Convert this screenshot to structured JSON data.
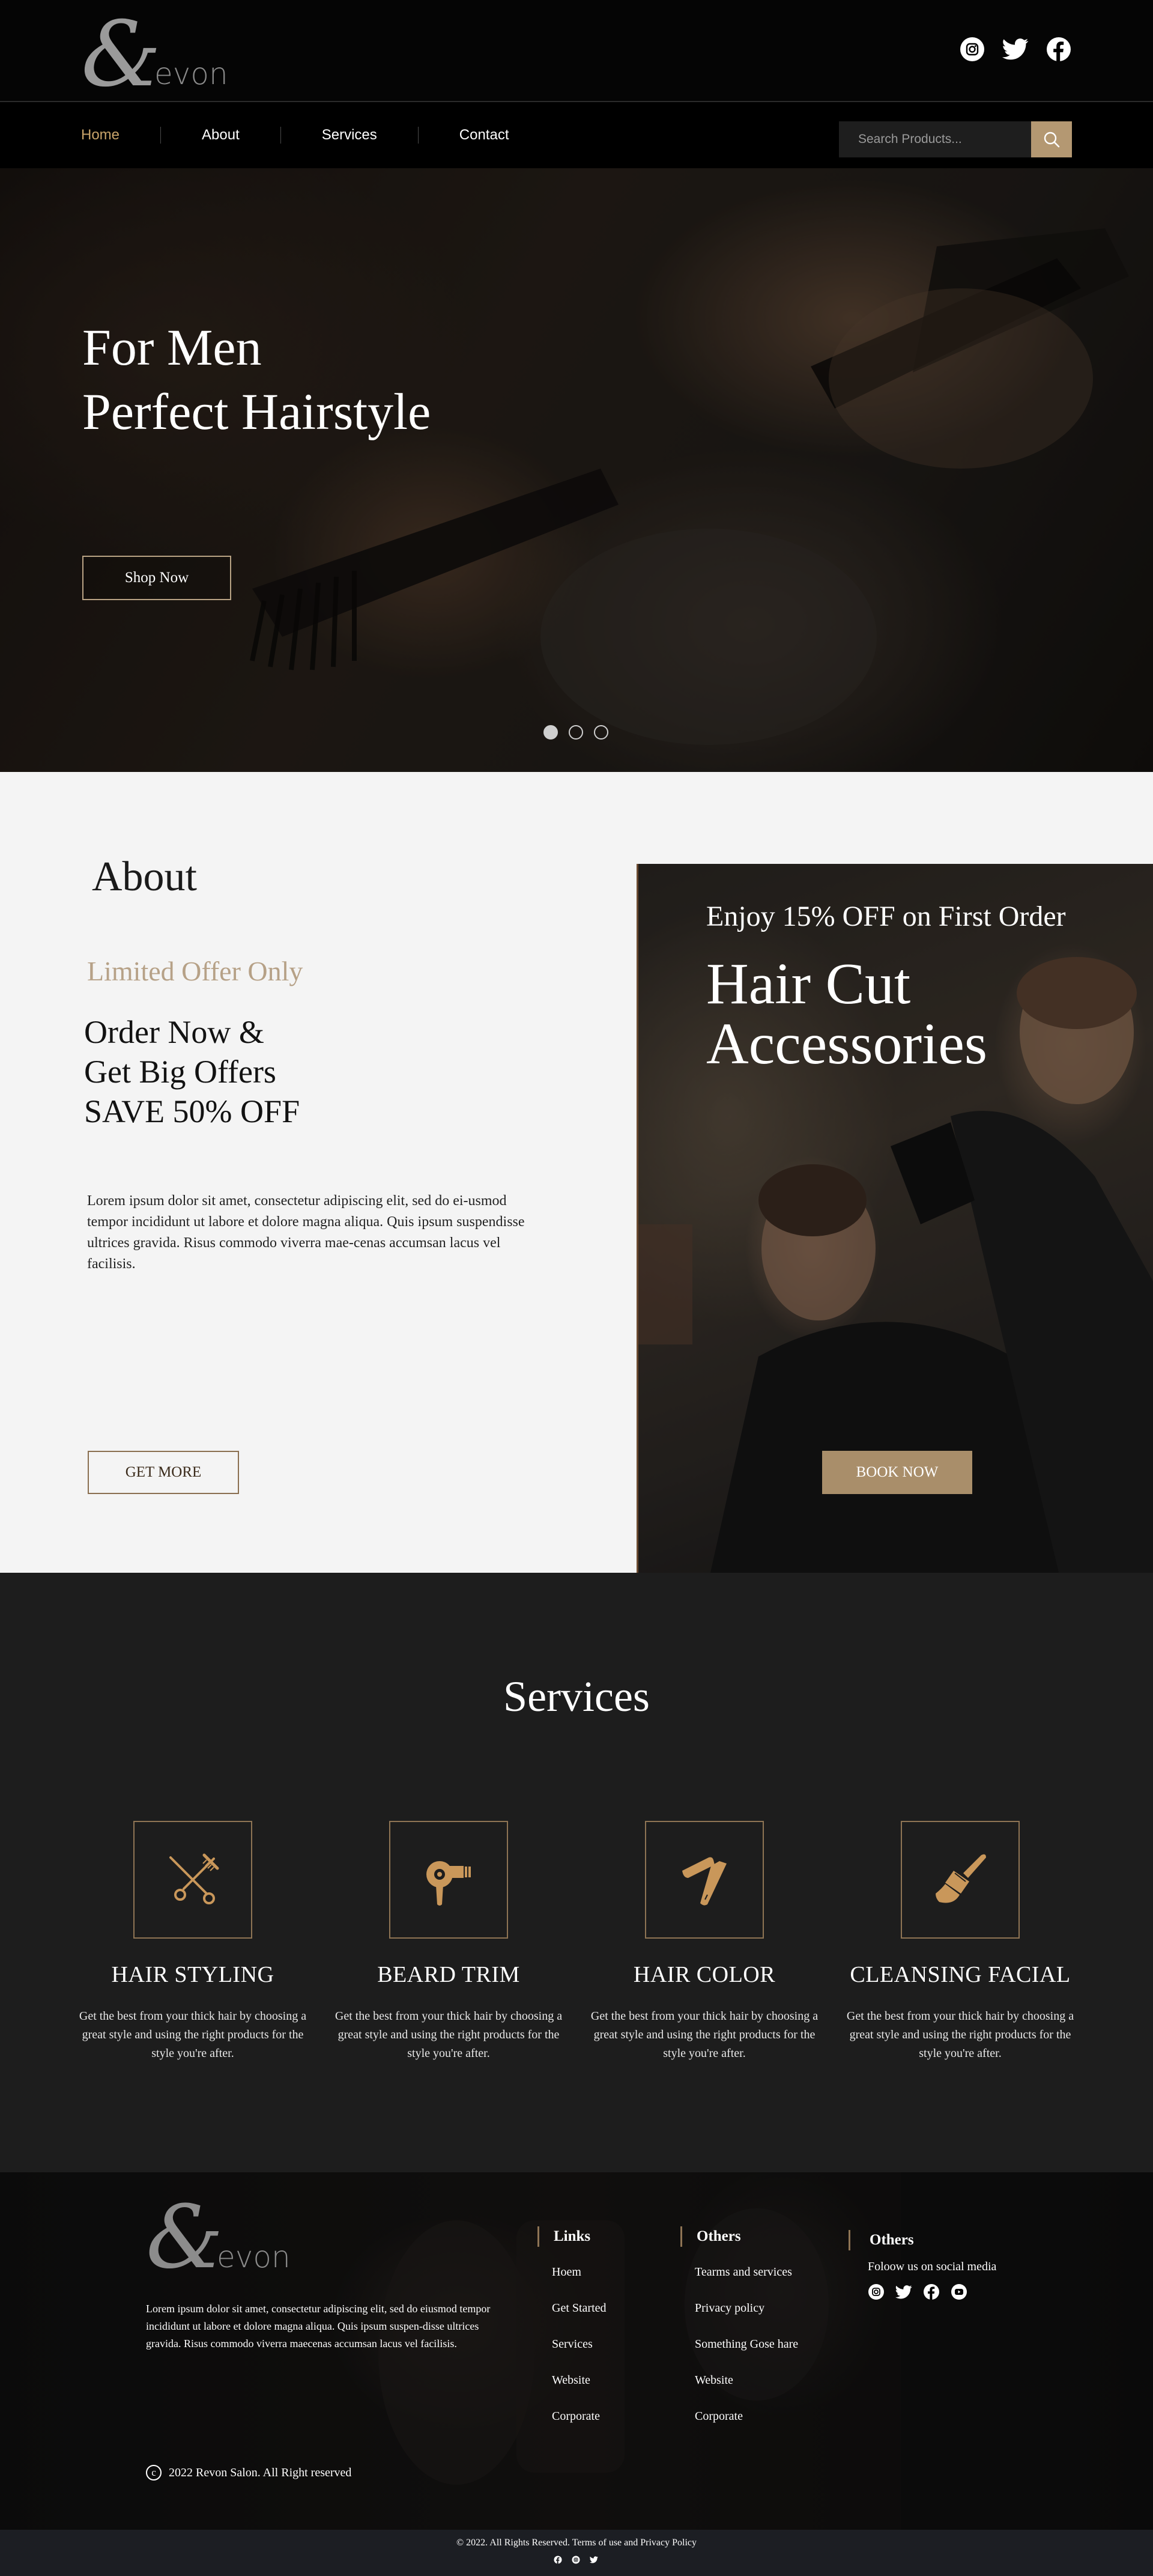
{
  "brand": {
    "monogram": "&",
    "name": "evon"
  },
  "colors": {
    "accent": "#c9a46a",
    "gold_border": "#8e7454",
    "dark": "#1d1d1d",
    "light_bg": "#f4f4f4"
  },
  "header": {
    "social_icons": [
      "instagram-icon",
      "twitter-icon",
      "facebook-icon"
    ]
  },
  "nav": {
    "items": [
      {
        "label": "Home",
        "active": true
      },
      {
        "label": "About"
      },
      {
        "label": "Services"
      },
      {
        "label": "Contact"
      }
    ],
    "search_placeholder": "Search Products...",
    "search_icon": "search-icon"
  },
  "hero": {
    "line1": "For Men",
    "line2": "Perfect Hairstyle",
    "cta": "Shop Now",
    "slides": 3,
    "active_slide": 1
  },
  "about": {
    "title": "About",
    "limited": "Limited Offer Only",
    "order_lines": [
      "Order Now &",
      "Get Big Offers",
      "SAVE 50% OFF"
    ],
    "paragraph": "Lorem ipsum dolor sit amet, consectetur adipiscing elit, sed do ei-usmod tempor incididunt ut labore et dolore magna aliqua. Quis ipsum suspendisse ultrices gravida. Risus commodo viverra mae-cenas accumsan lacus vel facilisis.",
    "cta": "GET MORE"
  },
  "promo": {
    "enjoy": "Enjoy 15% OFF on First Order",
    "line1": "Hair Cut",
    "line2": "Accessories",
    "cta": "BOOK NOW"
  },
  "services": {
    "title": "Services",
    "items": [
      {
        "name": "HAIR STYLING",
        "icon": "scissors-comb-icon",
        "desc": "Get the best from your thick hair by choosing a great style and using the right products for the style you're after."
      },
      {
        "name": "BEARD TRIM",
        "icon": "hair-dryer-icon",
        "desc": "Get the best from your thick hair by choosing a great style and using the right products for the style you're after."
      },
      {
        "name": "HAIR COLOR",
        "icon": "razor-icon",
        "desc": "Get the best from your thick hair by choosing a great style and using the right products for the style you're after."
      },
      {
        "name": "CLEANSING FACIAL",
        "icon": "brush-icon",
        "desc": "Get the best from your thick hair by choosing a great style and using the right products for the style you're after."
      }
    ]
  },
  "footer": {
    "paragraph": "Lorem ipsum dolor sit amet, consectetur adipiscing elit, sed do eiusmod tempor incididunt ut labore et dolore magna aliqua. Quis ipsum suspen-disse ultrices gravida. Risus commodo viverra maecenas accumsan lacus vel facilisis.",
    "copyright_symbol": "c",
    "copyright": "2022  Revon Salon. All Right reserved",
    "links": {
      "title": "Links",
      "items": [
        "Hoem",
        "Get Started",
        "Services",
        "Website",
        "Corporate"
      ]
    },
    "others": {
      "title": "Others",
      "items": [
        "Tearms and services",
        "Privacy policy",
        "Something Gose hare",
        "Website",
        "Corporate"
      ]
    },
    "social": {
      "title": "Others",
      "follow": "Foloow us on social media",
      "icons": [
        "instagram-icon",
        "twitter-icon",
        "facebook-icon",
        "youtube-icon"
      ]
    }
  },
  "bottombar": {
    "text": "© 2022. All Rights Reserved. Terms of use and Privacy Policy",
    "icons": [
      "facebook-icon",
      "instagram-icon",
      "twitter-icon"
    ]
  }
}
